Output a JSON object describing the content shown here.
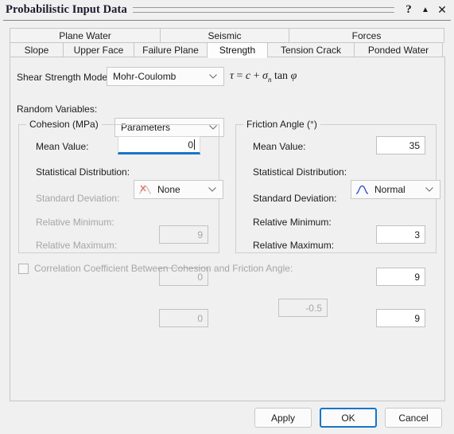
{
  "window": {
    "title": "Probabilistic Input Data",
    "controls": [
      {
        "name": "help-button",
        "glyph": "?"
      },
      {
        "name": "collapse-button",
        "glyph": "▲"
      },
      {
        "name": "close-button",
        "glyph": "✕"
      }
    ]
  },
  "tabs": {
    "top_row": [
      "Plane Water",
      "Seismic",
      "Forces"
    ],
    "bottom_row": [
      "Slope",
      "Upper Face",
      "Failure Plane",
      "Strength",
      "Tension Crack",
      "Ponded Water"
    ],
    "selected": "Strength"
  },
  "form": {
    "shear_strength_model_label": "Shear Strength Model:",
    "shear_strength_model_value": "Mohr-Coulomb",
    "random_variables_label": "Random Variables:",
    "random_variables_value": "Parameters",
    "formula": {
      "tau": "τ",
      "equals": "=",
      "c": "c",
      "plus": "+",
      "sigma": "σ",
      "sigma_sub": "n",
      "tan": "tan",
      "phi": "φ"
    }
  },
  "cohesion": {
    "legend": "Cohesion (MPa)",
    "fields": [
      {
        "label": "Mean Value:",
        "value": "0",
        "type": "text",
        "enabled": true,
        "focused": true
      },
      {
        "label": "Statistical Distribution:",
        "value": "None",
        "type": "combo",
        "enabled": true,
        "icon": "distribution-none-icon"
      },
      {
        "label": "Standard Deviation:",
        "value": "9",
        "type": "text",
        "enabled": false
      },
      {
        "label": "Relative Minimum:",
        "value": "0",
        "type": "text",
        "enabled": false
      },
      {
        "label": "Relative Maximum:",
        "value": "0",
        "type": "text",
        "enabled": false
      }
    ]
  },
  "friction_angle": {
    "legend": "Friction Angle (°)",
    "fields": [
      {
        "label": "Mean Value:",
        "value": "35",
        "type": "text",
        "enabled": true
      },
      {
        "label": "Statistical Distribution:",
        "value": "Normal",
        "type": "combo",
        "enabled": true,
        "icon": "distribution-normal-icon"
      },
      {
        "label": "Standard Deviation:",
        "value": "3",
        "type": "text",
        "enabled": true
      },
      {
        "label": "Relative Minimum:",
        "value": "9",
        "type": "text",
        "enabled": true
      },
      {
        "label": "Relative Maximum:",
        "value": "9",
        "type": "text",
        "enabled": true
      }
    ]
  },
  "correlation": {
    "label": "Correlation Coefficient Between Cohesion and Friction Angle:",
    "value": "-0.5",
    "checked": false,
    "enabled": false
  },
  "buttons": {
    "apply": "Apply",
    "ok": "OK",
    "cancel": "Cancel",
    "default": "OK"
  },
  "colors": {
    "accent": "#1975c5",
    "panel_bg": "#f0f0f0",
    "field_bg": "#ffffff",
    "disabled_text": "#a6a6a6",
    "dist_none_icon": "#e8776a",
    "dist_normal_icon": "#2a4fc4"
  }
}
